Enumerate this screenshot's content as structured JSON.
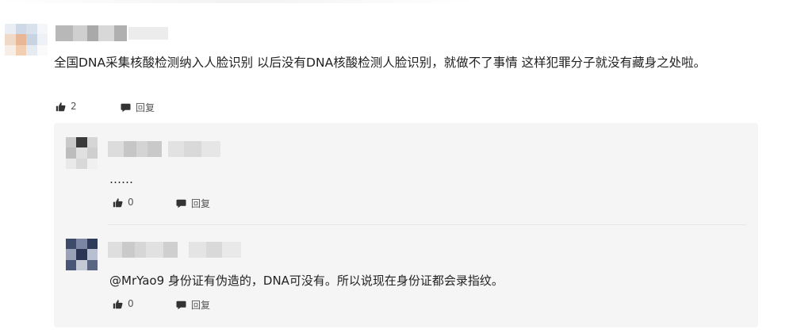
{
  "comment": {
    "text": "全国DNA采集核酸检测纳入人脸识别  以后没有DNA核酸检测人脸识别，就做不了事情  这样犯罪分子就没有藏身之处啦。",
    "like_count": "2",
    "reply_label": "回复"
  },
  "replies": [
    {
      "text": "……",
      "like_count": "0",
      "reply_label": "回复"
    },
    {
      "text": "@MrYao9 身份证有伪造的，DNA可没有。所以说现在身份证都会录指纹。",
      "like_count": "0",
      "reply_label": "回复"
    }
  ],
  "colors": {
    "text": "#222222",
    "meta": "#555555",
    "reply_background": "#f5f5f6",
    "divider": "#e6e6e6"
  },
  "icons": {
    "like": "thumbs-up-icon",
    "reply": "speech-bubble-icon"
  }
}
